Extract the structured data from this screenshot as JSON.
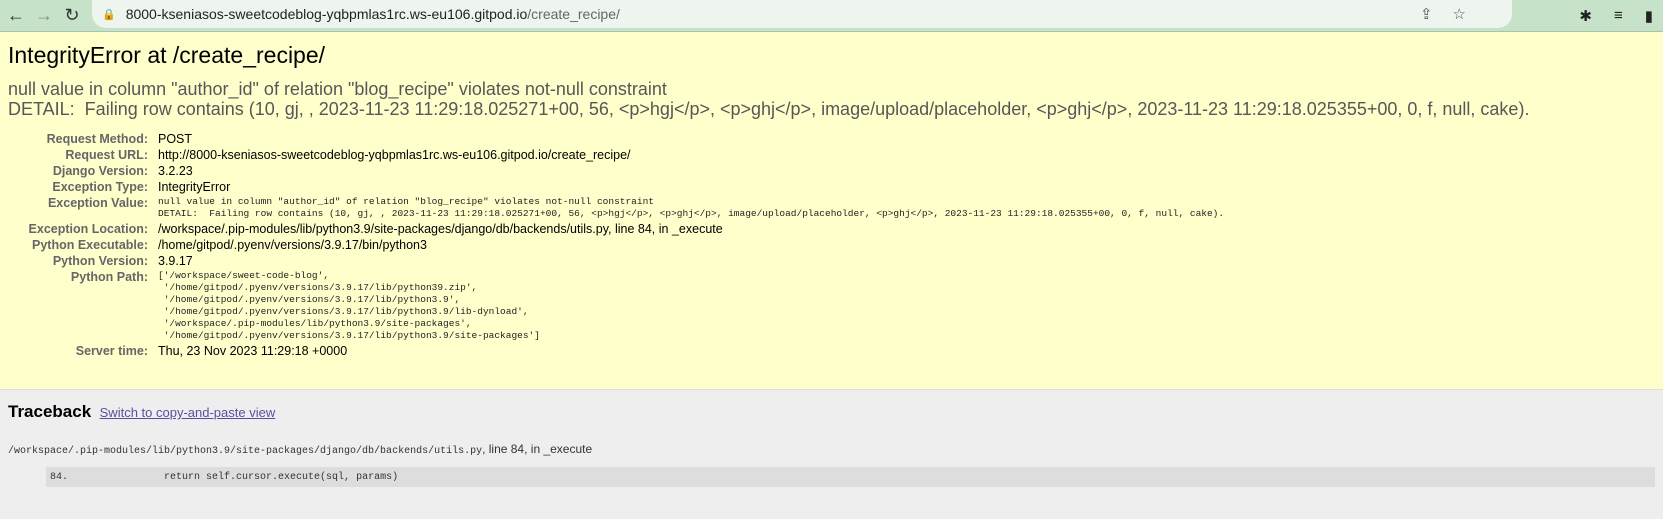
{
  "browser": {
    "url_host": "8000-kseniasos-sweetcodeblog-yqbpmlas1rc.ws-eu106.gitpod.io",
    "url_path": "/create_recipe/"
  },
  "error": {
    "title": "IntegrityError at /create_recipe/",
    "message": "null value in column \"author_id\" of relation \"blog_recipe\" violates not-null constraint\nDETAIL:  Failing row contains (10, gj, , 2023-11-23 11:29:18.025271+00, 56, <p>hgj</p>, <p>ghj</p>, image/upload/placeholder, <p>ghj</p>, 2023-11-23 11:29:18.025355+00, 0, f, null, cake).",
    "meta": [
      {
        "label": "Request Method:",
        "value": "POST"
      },
      {
        "label": "Request URL:",
        "value": "http://8000-kseniasos-sweetcodeblog-yqbpmlas1rc.ws-eu106.gitpod.io/create_recipe/"
      },
      {
        "label": "Django Version:",
        "value": "3.2.23"
      },
      {
        "label": "Exception Type:",
        "value": "IntegrityError"
      },
      {
        "label": "Exception Value:",
        "value": "null value in column \"author_id\" of relation \"blog_recipe\" violates not-null constraint\nDETAIL:  Failing row contains (10, gj, , 2023-11-23 11:29:18.025271+00, 56, <p>hgj</p>, <p>ghj</p>, image/upload/placeholder, <p>ghj</p>, 2023-11-23 11:29:18.025355+00, 0, f, null, cake)."
      },
      {
        "label": "Exception Location:",
        "value": "/workspace/.pip-modules/lib/python3.9/site-packages/django/db/backends/utils.py, line 84, in _execute"
      },
      {
        "label": "Python Executable:",
        "value": "/home/gitpod/.pyenv/versions/3.9.17/bin/python3"
      },
      {
        "label": "Python Version:",
        "value": "3.9.17"
      },
      {
        "label": "Python Path:",
        "value": "['/workspace/sweet-code-blog',\n '/home/gitpod/.pyenv/versions/3.9.17/lib/python39.zip',\n '/home/gitpod/.pyenv/versions/3.9.17/lib/python3.9',\n '/home/gitpod/.pyenv/versions/3.9.17/lib/python3.9/lib-dynload',\n '/workspace/.pip-modules/lib/python3.9/site-packages',\n '/home/gitpod/.pyenv/versions/3.9.17/lib/python3.9/site-packages']"
      },
      {
        "label": "Server time:",
        "value": "Thu, 23 Nov 2023 11:29:18 +0000"
      }
    ]
  },
  "traceback": {
    "heading": "Traceback",
    "switch_link": "Switch to copy-and-paste view",
    "frame_file": "/workspace/.pip-modules/lib/python3.9/site-packages/django/db/backends/utils.py",
    "frame_suffix": ", line 84, in _execute",
    "line_no": "84.",
    "line_code": "                return self.cursor.execute(sql, params)"
  }
}
